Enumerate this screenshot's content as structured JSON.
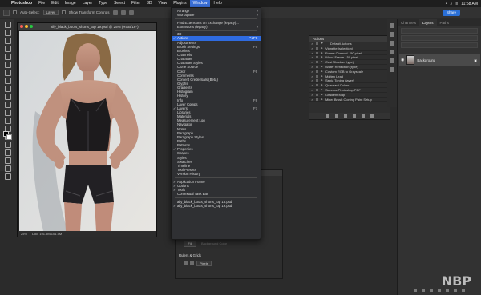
{
  "menubar": {
    "app": "Photoshop",
    "items": [
      "File",
      "Edit",
      "Image",
      "Layer",
      "Type",
      "Select",
      "Filter",
      "3D",
      "View",
      "Plugins",
      "Window",
      "Help"
    ],
    "active": "Window",
    "clock": "11:58 AM"
  },
  "options": {
    "auto_select": "Auto-Select:",
    "layer": "Layer",
    "transform": "Show Transform Controls",
    "share": "Share"
  },
  "document": {
    "title": "ally_black_boots_shorts_top 19.psd @ 25% (RGB/16*)",
    "zoom": "25%",
    "doc_size": "Doc: 101.5M/101.5M"
  },
  "window_menu": [
    {
      "label": "Arrange",
      "arrow": true
    },
    {
      "label": "Workspace",
      "arrow": true
    },
    {
      "sep": true
    },
    {
      "label": "Find Extensions on Exchange (legacy)..."
    },
    {
      "label": "Extensions (legacy)",
      "arrow": true
    },
    {
      "sep": true
    },
    {
      "label": "3D"
    },
    {
      "label": "Actions",
      "checked": true,
      "shortcut": "⌥F9",
      "highlight": true
    },
    {
      "label": "Adjustments"
    },
    {
      "label": "Brush Settings",
      "shortcut": "F5"
    },
    {
      "label": "Brushes"
    },
    {
      "label": "Channels"
    },
    {
      "label": "Character"
    },
    {
      "label": "Character Styles"
    },
    {
      "label": "Clone Source"
    },
    {
      "label": "Color",
      "shortcut": "F6"
    },
    {
      "label": "Comments"
    },
    {
      "label": "Content Credentials (Beta)"
    },
    {
      "label": "Glyphs"
    },
    {
      "label": "Gradients"
    },
    {
      "label": "Histogram"
    },
    {
      "label": "History"
    },
    {
      "label": "Info",
      "shortcut": "F8"
    },
    {
      "label": "Layer Comps"
    },
    {
      "label": "Layers",
      "checked": true,
      "shortcut": "F7"
    },
    {
      "label": "Libraries"
    },
    {
      "label": "Materials"
    },
    {
      "label": "Measurement Log"
    },
    {
      "label": "Navigator"
    },
    {
      "label": "Notes"
    },
    {
      "label": "Paragraph"
    },
    {
      "label": "Paragraph Styles"
    },
    {
      "label": "Paths"
    },
    {
      "label": "Patterns"
    },
    {
      "label": "Properties",
      "checked": true
    },
    {
      "label": "Shapes"
    },
    {
      "label": "Styles"
    },
    {
      "label": "Swatches"
    },
    {
      "label": "Timeline"
    },
    {
      "label": "Tool Presets"
    },
    {
      "label": "Version History"
    },
    {
      "sep": true
    },
    {
      "label": "Application Frame",
      "checked": true
    },
    {
      "label": "Options",
      "checked": true
    },
    {
      "label": "Tools",
      "checked": true
    },
    {
      "label": "Contextual Task Bar"
    },
    {
      "sep": true
    },
    {
      "label": "ally_black_boots_shorts_top 15.psd"
    },
    {
      "label": "ally_black_boots_shorts_top 19.psd",
      "checked": true
    }
  ],
  "actions_panel": {
    "title": "Actions",
    "items": [
      {
        "label": "Default Actions",
        "folder": true
      },
      {
        "label": "Vignette (selection)"
      },
      {
        "label": "Frame Channel - 50 pixel"
      },
      {
        "label": "Wood Frame - 50 pixel"
      },
      {
        "label": "Cast Shadow (type)"
      },
      {
        "label": "Water Reflection (type)"
      },
      {
        "label": "Custom RGB to Grayscale"
      },
      {
        "label": "Molten Lead"
      },
      {
        "label": "Sepia Toning (layer)"
      },
      {
        "label": "Quadrant Colors"
      },
      {
        "label": "Save as Photoshop PDF"
      },
      {
        "label": "Gradient Map"
      },
      {
        "label": "Mixer Brush Cloning Paint Setup"
      }
    ]
  },
  "layers_panel": {
    "tabs": [
      "Channels",
      "Layers",
      "Paths"
    ],
    "active_tab": "Layers",
    "layer_name": "Background"
  },
  "properties_panel": {
    "fill_label": "Fill",
    "background_color_label": "Background Color",
    "section": "Rulers & Grids",
    "units": "Pixels"
  },
  "watermark": "NBP",
  "colors": {
    "accent": "#2f6be0",
    "menu_bg": "#2f3033",
    "panel_bg": "#323232"
  }
}
